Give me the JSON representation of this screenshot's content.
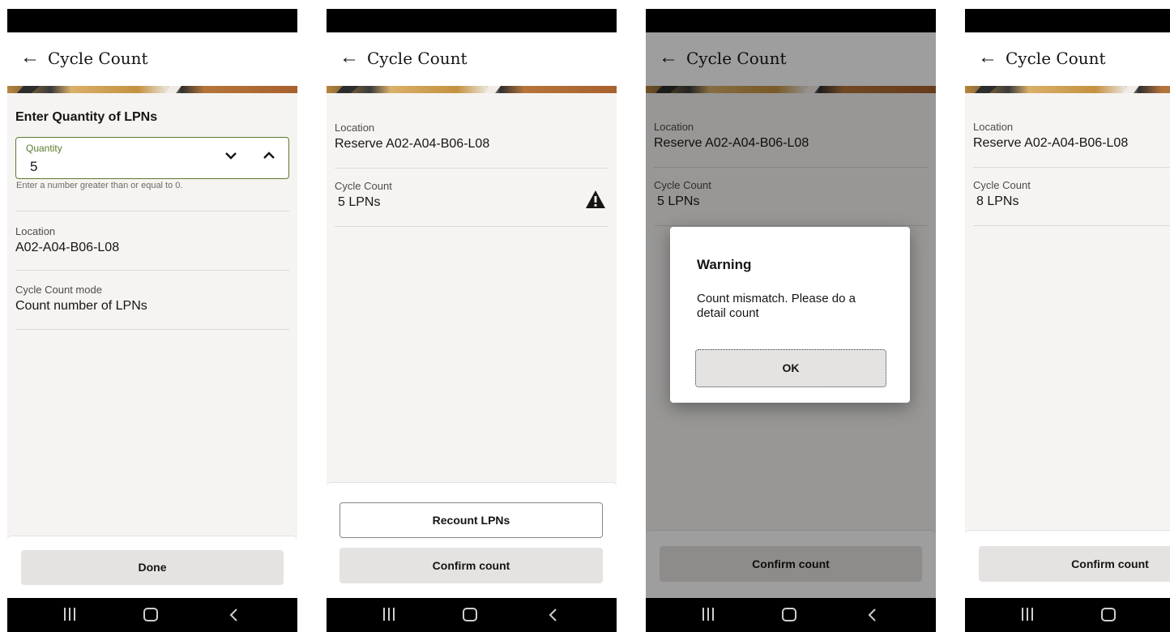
{
  "app": {
    "title": "Cycle Count"
  },
  "screen1": {
    "heading": "Enter Quantity of LPNs",
    "quantity_label": "Quantity",
    "quantity_value": "5",
    "quantity_help": "Enter a number greater than or equal to 0.",
    "location_label": "Location",
    "location_value": "A02-A04-B06-L08",
    "mode_label": "Cycle Count mode",
    "mode_value": "Count number of LPNs",
    "done_label": "Done"
  },
  "screen2": {
    "location_label": "Location",
    "location_value": "Reserve A02-A04-B06-L08",
    "count_label": "Cycle Count",
    "count_value": "5 LPNs",
    "recount_label": "Recount LPNs",
    "confirm_label": "Confirm count"
  },
  "screen3": {
    "location_label": "Location",
    "location_value": "Reserve A02-A04-B06-L08",
    "count_label": "Cycle Count",
    "count_value": "5 LPNs",
    "dialog_title": "Warning",
    "dialog_message": "Count mismatch. Please do a detail count",
    "ok_label": "OK",
    "confirm_label": "Confirm count"
  },
  "screen4": {
    "location_label": "Location",
    "location_value": "Reserve A02-A04-B06-L08",
    "count_label": "Cycle Count",
    "count_value": "8 LPNs",
    "confirm_label": "Confirm count"
  },
  "colors": {
    "accent_green": "#5c7a2d",
    "button_gray": "#e5e3e1",
    "background": "#f6f4f2",
    "banner_gold": "#c89a4a"
  },
  "icons": [
    "back-arrow-icon",
    "chevron-down-icon",
    "chevron-up-icon",
    "warning-icon",
    "nav-recent-icon",
    "nav-home-icon",
    "nav-back-icon"
  ]
}
